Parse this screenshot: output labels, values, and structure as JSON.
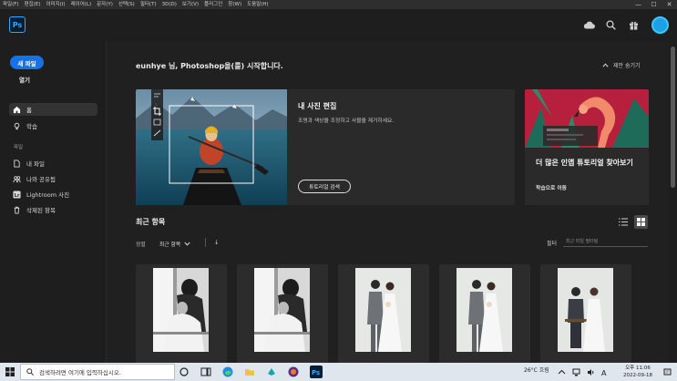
{
  "menubar": {
    "items": [
      "파일(F)",
      "편집(E)",
      "이미지(I)",
      "레이어(L)",
      "문자(Y)",
      "선택(S)",
      "필터(T)",
      "3D(D)",
      "보기(V)",
      "플러그인",
      "창(W)",
      "도움말(H)"
    ],
    "minimize": "—",
    "maximize": "☐",
    "close": "✕"
  },
  "app": {
    "logo": "Ps",
    "accent": "#1473e6"
  },
  "header_icons": [
    "cloud-icon",
    "search-icon",
    "gift-icon",
    "avatar"
  ],
  "sidebar": {
    "new_file": "새 파일",
    "open": "열기",
    "home": "홈",
    "learn": "학습",
    "section_files": "파일",
    "my_files": "내 파일",
    "shared": "나와 공유됨",
    "lightroom": "Lightroom 사진",
    "deleted": "삭제된 항목"
  },
  "main": {
    "welcome": "eunhye 님, Photoshop을(를) 시작합니다.",
    "hide_suggestions": "제안 숨기기",
    "card_edit": {
      "title": "내 사진 편집",
      "desc": "조명과 색상을 조정하고 사물을 제거하세요.",
      "button": "튜토리얼 검색"
    },
    "card_more": {
      "title": "더 많은 인앱 튜토리얼 찾아보기",
      "sub": "학습으로 이동"
    },
    "recent": {
      "title": "최근 항목",
      "sort_label": "정렬",
      "sort_value": "최근 항목",
      "sort_dir": "↓",
      "filter_label": "필터",
      "filter_placeholder": "최근 파일 필터링"
    }
  },
  "taskbar": {
    "search_placeholder": "검색하려면 여기에 입력하십시오.",
    "weather": "26°C  흐림",
    "time": "오후 11:06",
    "date": "2022-09-18"
  }
}
